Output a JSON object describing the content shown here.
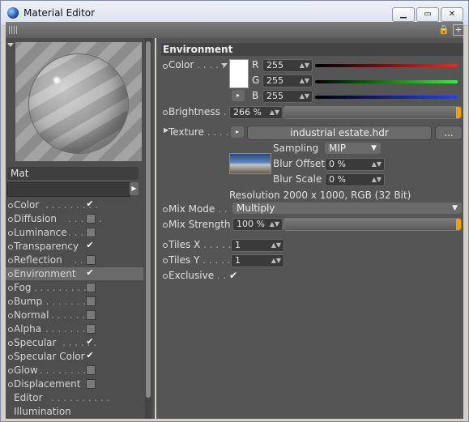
{
  "window": {
    "title": "Material Editor"
  },
  "left": {
    "material_name": "Mat",
    "channels": [
      {
        "label": "Color",
        "dots": ". . . . . . . . .",
        "checked": true
      },
      {
        "label": "Diffusion",
        "dots": ". . . . . .",
        "checked": false
      },
      {
        "label": "Luminance",
        "dots": ". . . . .",
        "checked": false
      },
      {
        "label": "Transparency",
        "dots": "",
        "checked": true
      },
      {
        "label": "Reflection",
        "dots": ". . . .",
        "checked": false
      },
      {
        "label": "Environment",
        "dots": "",
        "checked": true
      },
      {
        "label": "Fog",
        "dots": ". . . . . . . . . .",
        "checked": false
      },
      {
        "label": "Bump",
        "dots": ". . . . . . . .",
        "checked": false
      },
      {
        "label": "Normal",
        "dots": ". . . . . . .",
        "checked": false
      },
      {
        "label": "Alpha",
        "dots": ". . . . . . . .",
        "checked": false
      },
      {
        "label": "Specular",
        "dots": ". . . . . .",
        "checked": true
      },
      {
        "label": "Specular Color",
        "dots": "",
        "checked": true
      },
      {
        "label": "Glow",
        "dots": ". . . . . . . . .",
        "checked": false
      },
      {
        "label": "Displacement",
        "dots": "",
        "checked": false
      },
      {
        "label": "Editor",
        "dots": ". . . . . . . . . .",
        "checked": null
      },
      {
        "label": "Illumination",
        "dots": "",
        "checked": null
      }
    ]
  },
  "right": {
    "section_title": "Environment",
    "color": {
      "label": "Color",
      "dots": ". . . . .",
      "r_label": "R",
      "g_label": "G",
      "b_label": "B",
      "r": "255",
      "g": "255",
      "b": "255",
      "swatch": "#ffffff"
    },
    "brightness": {
      "label": "Brightness",
      "dots": ". .",
      "value": "266 %",
      "fraction": 1.0
    },
    "texture": {
      "label": "Texture",
      "dots": ". . . . .",
      "file": "industrial estate.hdr",
      "more": "...",
      "sampling_label": "Sampling",
      "sampling_value": "MIP",
      "blur_offset_label": "Blur Offset",
      "blur_offset_value": "0 %",
      "blur_scale_label": "Blur Scale",
      "blur_scale_value": "0 %",
      "resolution": "Resolution 2000 x 1000, RGB (32 Bit)"
    },
    "mix_mode": {
      "label": "Mix Mode",
      "dots": ". .",
      "value": "Multiply"
    },
    "mix_strength": {
      "label": "Mix Strength",
      "value": "100 %",
      "fraction": 1.0
    },
    "tiles_x": {
      "label": "Tiles X",
      "dots": ". . . . .",
      "value": "1"
    },
    "tiles_y": {
      "label": "Tiles Y",
      "dots": ". . . . .",
      "value": "1"
    },
    "exclusive": {
      "label": "Exclusive",
      "dots": ". .",
      "checked": true
    }
  },
  "colors": {
    "panel": "#555555",
    "accent": "#f0a000"
  }
}
